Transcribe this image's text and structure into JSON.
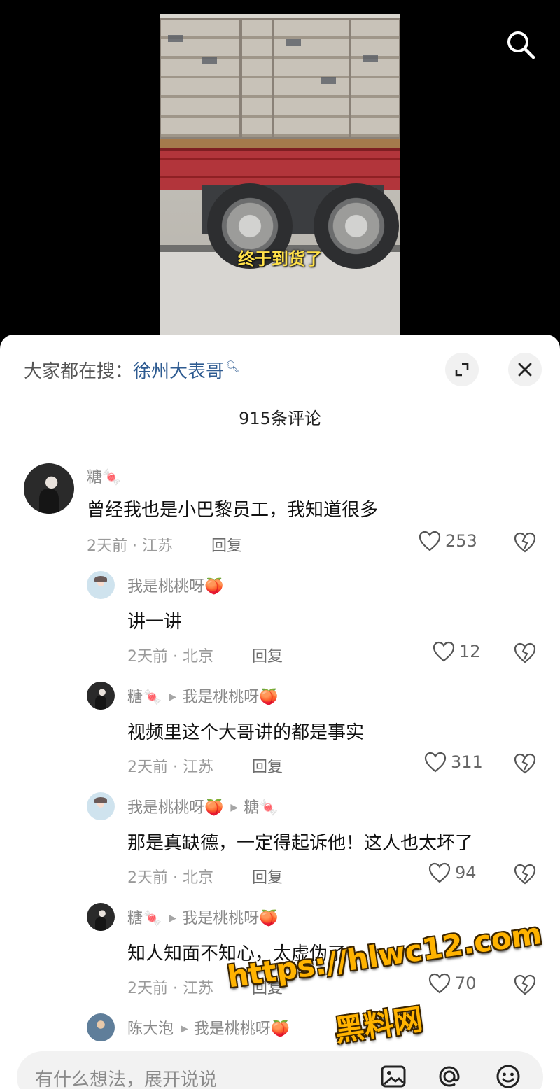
{
  "video": {
    "caption": "终于到货了"
  },
  "sheet": {
    "search_prefix": "大家都在搜：",
    "search_keyword": "徐州大表哥",
    "comment_count_title": "915条评论"
  },
  "comments": [
    {
      "user": "糖🍬",
      "text": "曾经我也是小巴黎员工，我知道很多",
      "meta": "2天前 · 江苏",
      "reply_label": "回复",
      "likes": "253"
    },
    {
      "user": "我是桃桃呀🍑",
      "text": "讲一讲",
      "meta": "2天前 · 北京",
      "reply_label": "回复",
      "likes": "12"
    },
    {
      "user": "糖🍬",
      "reply_to": "我是桃桃呀🍑",
      "text": "视频里这个大哥讲的都是事实",
      "meta": "2天前 · 江苏",
      "reply_label": "回复",
      "likes": "311"
    },
    {
      "user": "我是桃桃呀🍑",
      "reply_to": "糖🍬",
      "text": "那是真缺德，一定得起诉他！这人也太坏了",
      "meta": "2天前 · 北京",
      "reply_label": "回复",
      "likes": "94"
    },
    {
      "user": "糖🍬",
      "reply_to": "我是桃桃呀🍑",
      "text": "知人知面不知心，太虚伪了",
      "meta": "2天前 · 江苏",
      "reply_label": "回复",
      "likes": "70"
    },
    {
      "user": "陈大泡",
      "reply_to": "我是桃桃呀🍑"
    }
  ],
  "input": {
    "placeholder": "有什么想法，展开说说"
  },
  "watermark": {
    "url": "https://hlwc12.com",
    "name": "黑料网"
  },
  "icons": {
    "search": "search-icon",
    "expand": "expand-icon",
    "close": "close-icon",
    "like": "heart-icon",
    "dislike": "broken-heart-icon",
    "image": "image-icon",
    "mention": "at-icon",
    "emoji": "emoji-icon"
  },
  "colors": {
    "keyword_link": "#2e5b91",
    "caption": "#ffe14a",
    "watermark": "#ffb300"
  }
}
